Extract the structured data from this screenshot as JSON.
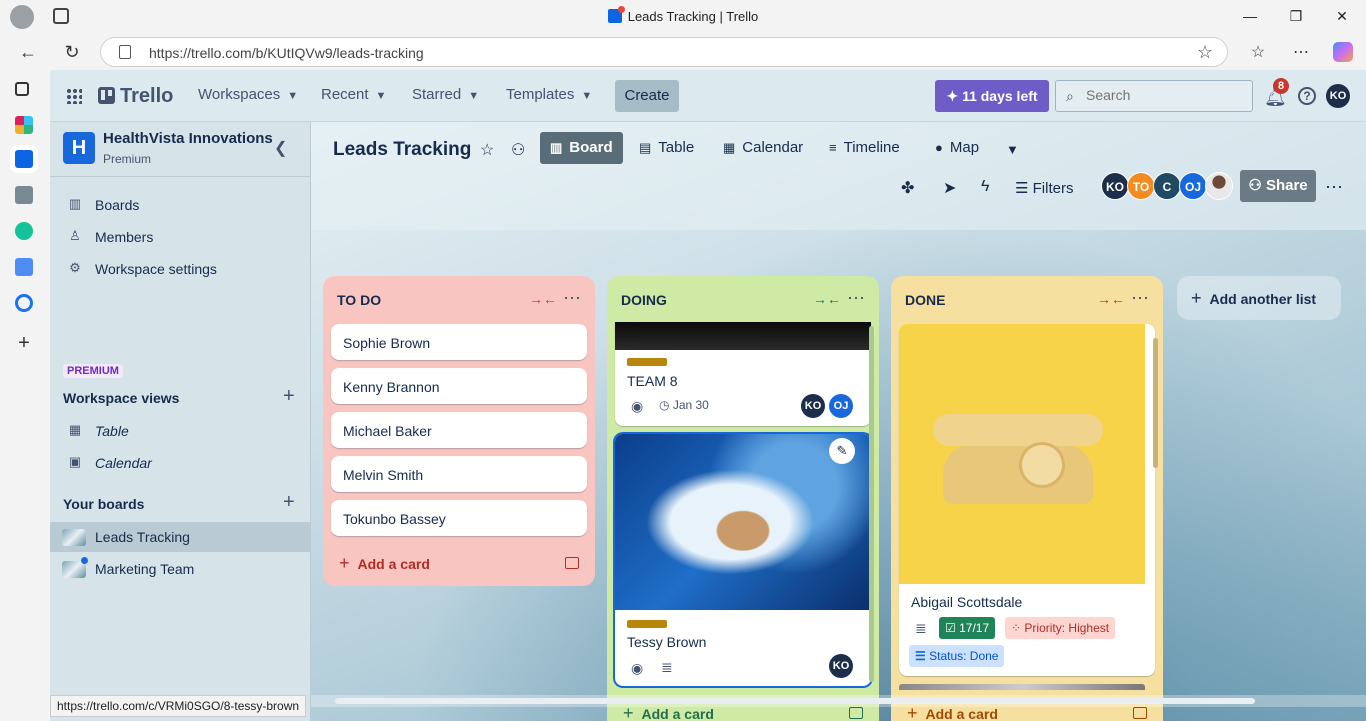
{
  "browser": {
    "tab_title": "Leads Tracking | Trello",
    "url": "https://trello.com/b/KUtIQVw9/leads-tracking",
    "status_url": "https://trello.com/c/VRMi0SGO/8-tessy-brown"
  },
  "topnav": {
    "logo": "Trello",
    "menus": [
      "Workspaces",
      "Recent",
      "Starred",
      "Templates"
    ],
    "create": "Create",
    "trial": "11 days left",
    "search_placeholder": "Search",
    "notification_count": "8",
    "user_initials": "KO"
  },
  "workspace": {
    "initial": "H",
    "name": "HealthVista Innovations",
    "plan": "Premium",
    "nav": [
      "Boards",
      "Members",
      "Workspace settings"
    ],
    "premium_badge": "PREMIUM",
    "views_title": "Workspace views",
    "views": [
      "Table",
      "Calendar"
    ],
    "boards_title": "Your boards",
    "boards": [
      "Leads Tracking",
      "Marketing Team"
    ]
  },
  "board": {
    "title": "Leads Tracking",
    "views": [
      "Board",
      "Table",
      "Calendar",
      "Timeline",
      "Map"
    ],
    "filters": "Filters",
    "members": [
      "KO",
      "TO",
      "C",
      "OJ"
    ],
    "share": "Share",
    "add_list": "Add another list"
  },
  "lists": [
    {
      "title": "TO DO",
      "cards": [
        "Sophie Brown",
        "Kenny Brannon",
        "Michael Baker",
        "Melvin Smith",
        "Tokunbo Bassey"
      ],
      "add_card": "Add a card"
    },
    {
      "title": "DOING",
      "cards": [
        {
          "title": "TEAM 8",
          "due": "Jan 30",
          "members": [
            "KO",
            "OJ"
          ]
        },
        {
          "title": "Tessy Brown",
          "members": [
            "KO"
          ]
        }
      ],
      "add_card": "Add a card"
    },
    {
      "title": "DONE",
      "cards": [
        {
          "title": "Abigail Scottsdale",
          "checklist": "17/17",
          "priority": "Priority: Highest",
          "status": "Status: Done"
        }
      ],
      "add_card": "Add a card"
    }
  ],
  "colors": {
    "todo_list": "#f9c5c1",
    "doing_list": "#cfeaa4",
    "done_list": "#f5e0a0",
    "trial_button": "#6e5dc6",
    "member_ko": "#1d2e4a",
    "member_to": "#f38b22",
    "member_c": "#1f4a61",
    "member_oj": "#1868db"
  }
}
